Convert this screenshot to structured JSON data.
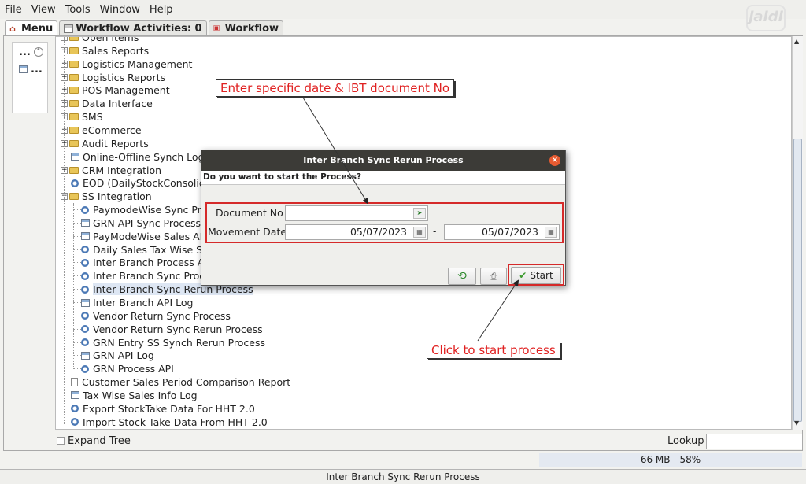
{
  "menubar": {
    "file": "File",
    "view": "View",
    "tools": "Tools",
    "window": "Window",
    "help": "Help"
  },
  "logo": {
    "text": "jaldi"
  },
  "tabs": [
    {
      "label": "Menu"
    },
    {
      "label": "Workflow Activities: 0"
    },
    {
      "label": "Workflow"
    }
  ],
  "left_panel": {
    "row1": "...",
    "row2": "..."
  },
  "tree": {
    "items": [
      {
        "label": "Open Items",
        "icon": "folder-icon",
        "expander": "plus"
      },
      {
        "label": "Sales Reports",
        "icon": "folder-icon",
        "expander": "plus"
      },
      {
        "label": "Logistics Management",
        "icon": "folder-icon",
        "expander": "plus"
      },
      {
        "label": "Logistics Reports",
        "icon": "folder-icon",
        "expander": "plus"
      },
      {
        "label": "POS Management",
        "icon": "folder-icon",
        "expander": "plus"
      },
      {
        "label": "Data Interface",
        "icon": "folder-icon",
        "expander": "plus"
      },
      {
        "label": "SMS",
        "icon": "folder-icon",
        "expander": "plus"
      },
      {
        "label": "eCommerce",
        "icon": "folder-icon",
        "expander": "plus"
      },
      {
        "label": "Audit Reports",
        "icon": "folder-icon",
        "expander": "plus"
      },
      {
        "label": "Online-Offline Synch Log",
        "icon": "report-icon",
        "expander": ""
      },
      {
        "label": "CRM Integration",
        "icon": "folder-icon",
        "expander": "plus"
      },
      {
        "label": "EOD (DailyStockConsolidation)",
        "icon": "process-icon",
        "expander": ""
      },
      {
        "label": "SS Integration",
        "icon": "folder-open-icon",
        "expander": "minus"
      },
      {
        "label": "PaymodeWise Sync Process",
        "icon": "process-icon",
        "expander": ""
      },
      {
        "label": "GRN API Sync Process",
        "icon": "report-icon",
        "expander": ""
      },
      {
        "label": "PayModeWise Sales API Log",
        "icon": "report-icon",
        "expander": ""
      },
      {
        "label": "Daily Sales Tax Wise Sync",
        "icon": "process-icon",
        "expander": ""
      },
      {
        "label": "Inter Branch Process API",
        "icon": "process-icon",
        "expander": ""
      },
      {
        "label": "Inter Branch Sync Process",
        "icon": "process-icon",
        "expander": ""
      },
      {
        "label": "Inter Branch Sync Rerun Process",
        "icon": "process-icon",
        "expander": "",
        "selected": true
      },
      {
        "label": "Inter Branch API Log",
        "icon": "report-icon",
        "expander": ""
      },
      {
        "label": "Vendor Return Sync Process",
        "icon": "process-icon",
        "expander": ""
      },
      {
        "label": "Vendor Return Sync Rerun Process",
        "icon": "process-icon",
        "expander": ""
      },
      {
        "label": "GRN Entry SS Synch Rerun Process",
        "icon": "process-icon",
        "expander": ""
      },
      {
        "label": "GRN API Log",
        "icon": "report-icon",
        "expander": ""
      },
      {
        "label": "GRN Process API",
        "icon": "process-icon",
        "expander": ""
      },
      {
        "label": "Customer Sales Period Comparison Report",
        "icon": "document-icon",
        "expander": ""
      },
      {
        "label": "Tax Wise Sales Info Log",
        "icon": "report-icon",
        "expander": ""
      },
      {
        "label": "Export StockTake Data For HHT 2.0",
        "icon": "process-icon",
        "expander": ""
      },
      {
        "label": "Import Stock Take Data From HHT 2.0",
        "icon": "process-icon",
        "expander": ""
      }
    ]
  },
  "bottom": {
    "expand_tree": "Expand Tree",
    "lookup": "Lookup",
    "lookup_value": ""
  },
  "memory": "66 MB - 58%",
  "status": "Inter Branch Sync Rerun Process",
  "dialog": {
    "title": "Inter Branch Sync Rerun Process",
    "question": "Do you want to start the Process?",
    "document_no_label": "Document No",
    "document_no_value": "",
    "movement_date_label": "Movement Date",
    "date_from": "05/07/2023",
    "date_to": "05/07/2023",
    "dash": "-",
    "start_label": "Start"
  },
  "callouts": {
    "top": "Enter specific date & IBT document No",
    "bottom": "Click to start process"
  },
  "colors": {
    "accent_red": "#d52a2a",
    "title_bar": "#3c3b37",
    "close_button": "#e75b31"
  }
}
